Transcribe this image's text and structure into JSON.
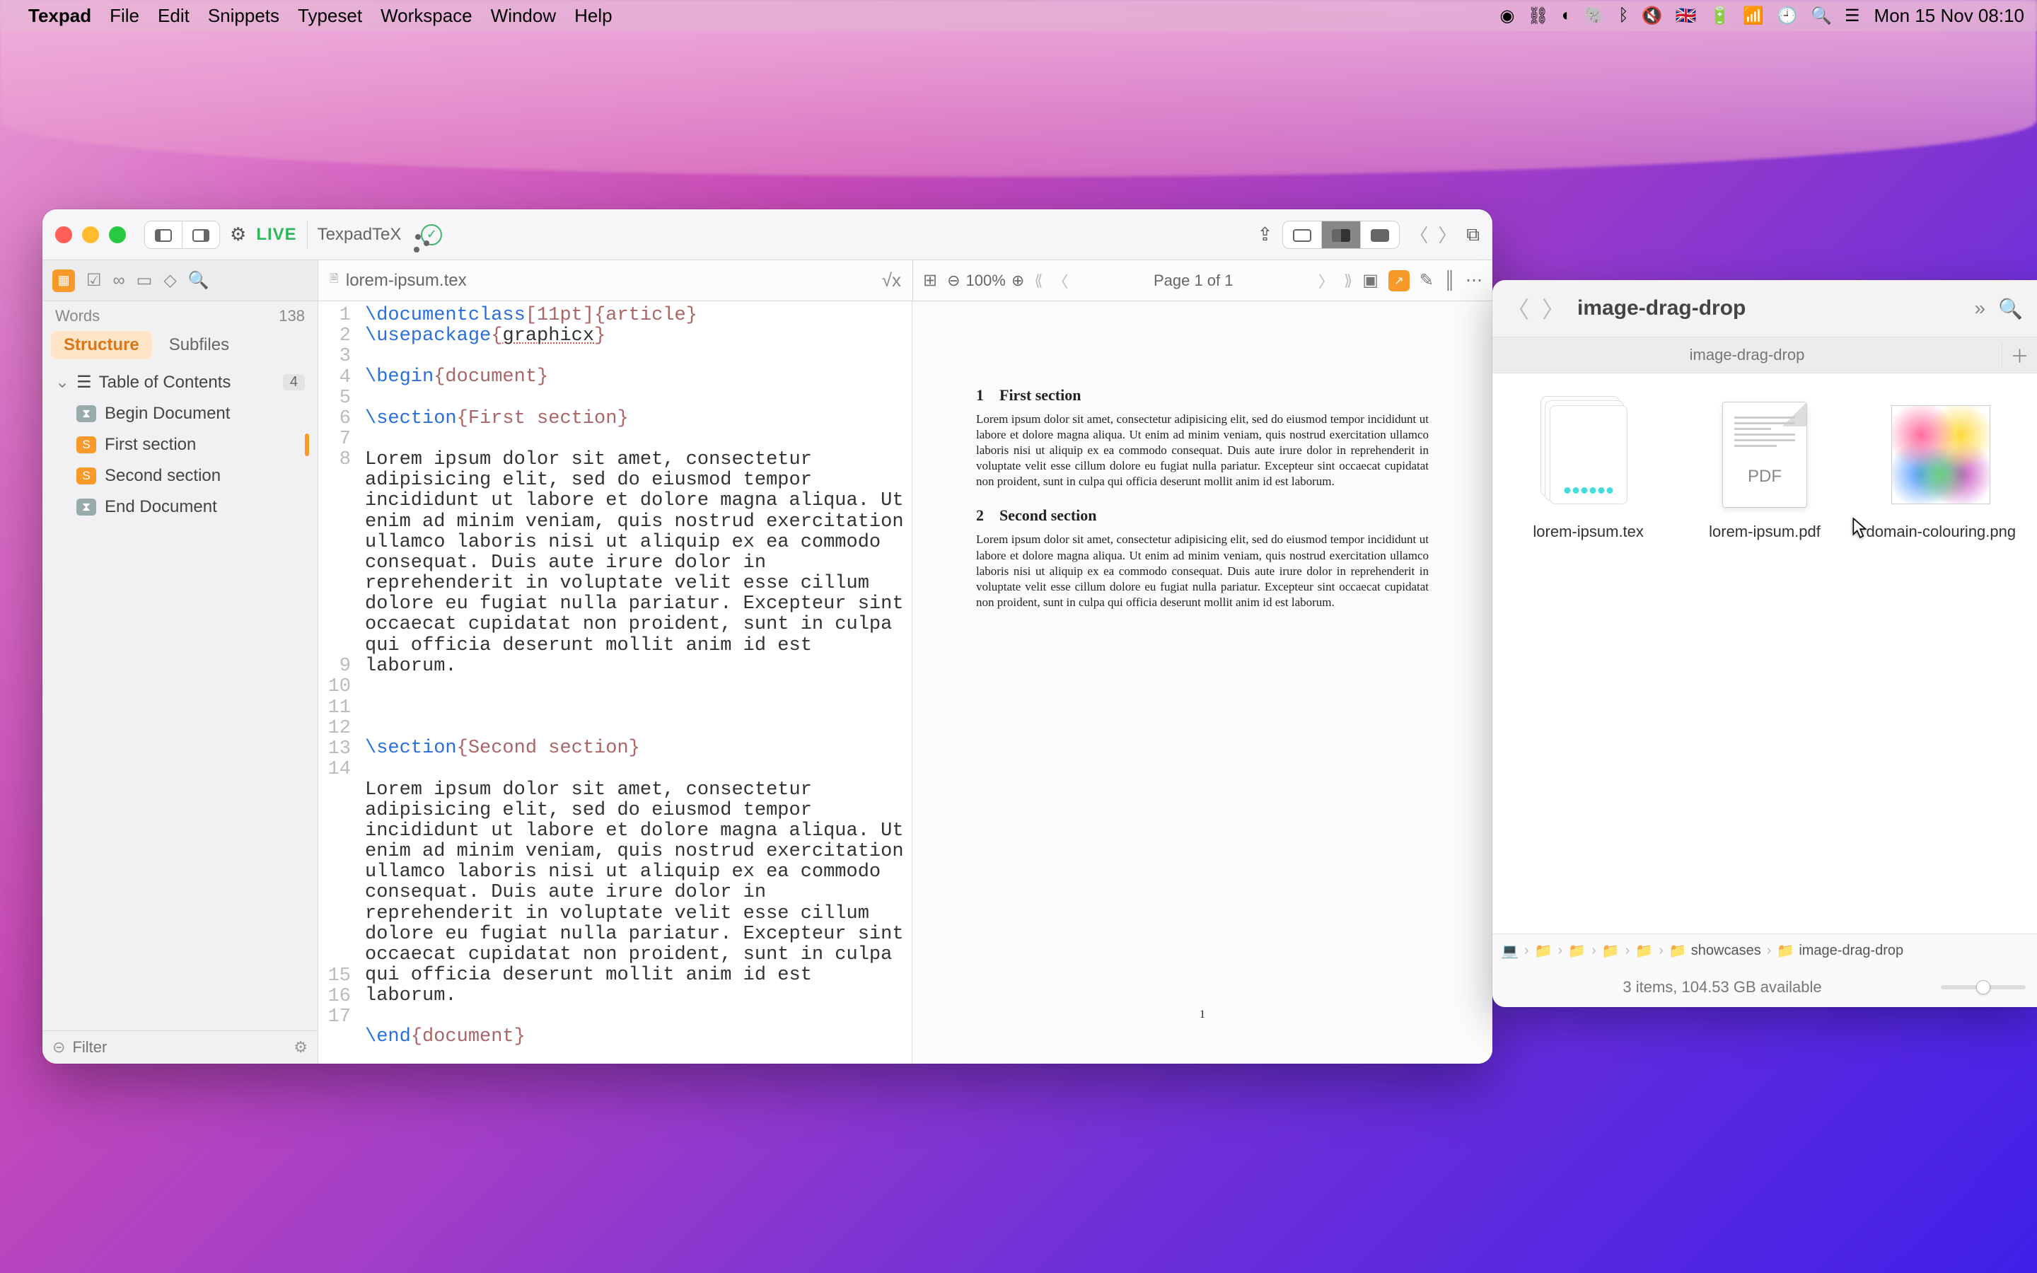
{
  "menubar": {
    "app": "Texpad",
    "items": [
      "File",
      "Edit",
      "Snippets",
      "Typeset",
      "Workspace",
      "Window",
      "Help"
    ],
    "flag": "🇬🇧",
    "datetime": "Mon 15 Nov  08:10"
  },
  "toolbar": {
    "live": "LIVE",
    "engine": "TexpadTeX"
  },
  "subbar": {
    "filename": "lorem-ipsum.tex",
    "zoom": "100%",
    "page": "Page 1 of 1"
  },
  "sidebar": {
    "words_label": "Words",
    "words_count": "138",
    "tabs": [
      "Structure",
      "Subfiles"
    ],
    "toc_title": "Table of Contents",
    "toc_count": "4",
    "items": [
      {
        "label": "Begin Document",
        "kind": "begin"
      },
      {
        "label": "First section",
        "kind": "sec",
        "current": true
      },
      {
        "label": "Second section",
        "kind": "sec"
      },
      {
        "label": "End Document",
        "kind": "begin"
      }
    ],
    "filter_placeholder": "Filter"
  },
  "code": {
    "l1a": "\\documentclass",
    "l1b": "[11pt]",
    "l1c": "{article}",
    "l2a": "\\usepackage",
    "l2b": "{",
    "l2c": "graphicx",
    "l2d": "}",
    "l4a": "\\begin",
    "l4b": "{document}",
    "l6a": "\\section",
    "l6b": "{First section}",
    "para": "Lorem ipsum dolor sit amet, consectetur adipisicing elit, sed do eiusmod tempor incididunt ut labore et dolore magna aliqua. Ut enim ad minim veniam, quis nostrud exercitation ullamco laboris nisi ut aliquip ex ea commodo consequat. Duis aute irure dolor in reprehenderit in voluptate velit esse cillum dolore eu fugiat nulla pariatur. Excepteur sint occaecat cupidatat non proident, sunt in culpa qui officia deserunt mollit anim id est laborum.",
    "l12a": "\\section",
    "l12b": "{Second section}",
    "l16a": "\\end",
    "l16b": "{document}"
  },
  "preview": {
    "h1": "1 First section",
    "h2": "2 Second section",
    "para": "Lorem ipsum dolor sit amet, consectetur adipisicing elit, sed do eiusmod tempor incididunt ut labore et dolore magna aliqua. Ut enim ad minim veniam, quis nostrud exercitation ullamco laboris nisi ut aliquip ex ea commodo consequat. Duis aute irure dolor in reprehenderit in voluptate velit esse cillum dolore eu fugiat nulla pariatur. Excepteur sint occaecat cupidatat non proident, sunt in culpa qui officia deserunt mollit anim id est laborum.",
    "pgnum": "1"
  },
  "finder": {
    "title": "image-drag-drop",
    "tab": "image-drag-drop",
    "files": [
      {
        "name": "lorem-ipsum.tex",
        "kind": "tex"
      },
      {
        "name": "lorem-ipsum.pdf",
        "kind": "pdf"
      },
      {
        "name": "domain-colouring.png",
        "kind": "img"
      }
    ],
    "pdf_label": "PDF",
    "path_last2": [
      "showcases",
      "image-drag-drop"
    ],
    "status": "3 items, 104.53 GB available"
  }
}
